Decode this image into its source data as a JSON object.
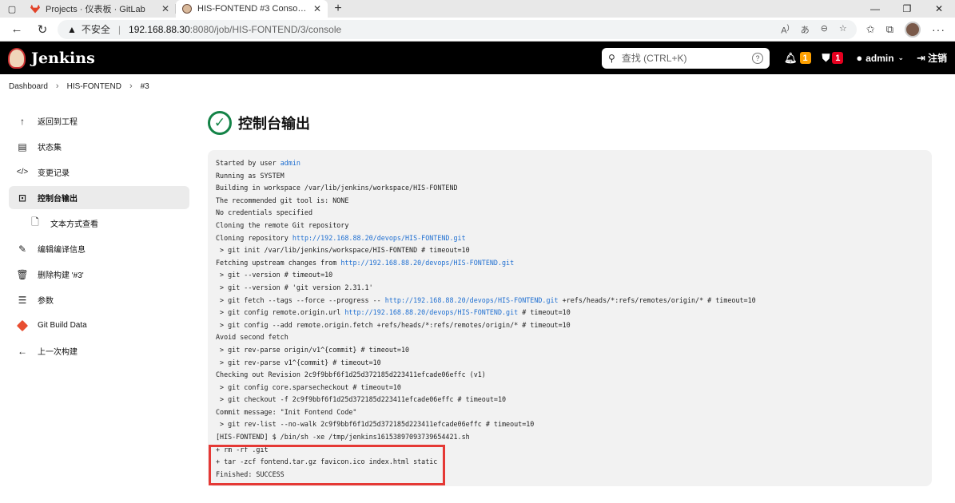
{
  "browser": {
    "tabs": [
      {
        "title": "Projects · 仪表板 · GitLab",
        "active": false
      },
      {
        "title": "HIS-FONTEND #3 Console [Jenkins]",
        "active": true
      }
    ],
    "url": {
      "warning": "不安全",
      "host": "192.168.88.30",
      "path": ":8080/job/HIS-FONTEND/3/console"
    }
  },
  "header": {
    "title": "Jenkins",
    "search_placeholder": "查找 (CTRL+K)",
    "notifications_count": "1",
    "security_count": "1",
    "user": "admin",
    "logout": "注销"
  },
  "breadcrumb": [
    "Dashboard",
    "HIS-FONTEND",
    "#3"
  ],
  "sidebar": {
    "items": [
      {
        "label": "返回到工程",
        "icon": "arrow-up-icon"
      },
      {
        "label": "状态集",
        "icon": "document-icon"
      },
      {
        "label": "变更记录",
        "icon": "code-icon"
      },
      {
        "label": "控制台输出",
        "icon": "terminal-icon",
        "active": true
      },
      {
        "label": "文本方式查看",
        "icon": "file-icon",
        "sub": true
      },
      {
        "label": "编辑编译信息",
        "icon": "edit-icon"
      },
      {
        "label": "删除构建 '#3'",
        "icon": "trash-icon"
      },
      {
        "label": "参数",
        "icon": "sliders-icon"
      },
      {
        "label": "Git Build Data",
        "icon": "git-icon"
      },
      {
        "label": "上一次构建",
        "icon": "arrow-left-icon"
      }
    ]
  },
  "main": {
    "title": "控制台输出"
  },
  "console": {
    "lines": [
      {
        "pre": "Started by user ",
        "link": "admin",
        "post": ""
      },
      {
        "pre": "Running as SYSTEM"
      },
      {
        "pre": "Building in workspace /var/lib/jenkins/workspace/HIS-FONTEND"
      },
      {
        "pre": "The recommended git tool is: NONE"
      },
      {
        "pre": "No credentials specified"
      },
      {
        "pre": "Cloning the remote Git repository"
      },
      {
        "pre": "Cloning repository ",
        "link": "http://192.168.88.20/devops/HIS-FONTEND.git",
        "post": ""
      },
      {
        "pre": " > git init /var/lib/jenkins/workspace/HIS-FONTEND # timeout=10"
      },
      {
        "pre": "Fetching upstream changes from ",
        "link": "http://192.168.88.20/devops/HIS-FONTEND.git",
        "post": ""
      },
      {
        "pre": " > git --version # timeout=10"
      },
      {
        "pre": " > git --version # 'git version 2.31.1'"
      },
      {
        "pre": " > git fetch --tags --force --progress -- ",
        "link": "http://192.168.88.20/devops/HIS-FONTEND.git",
        "post": " +refs/heads/*:refs/remotes/origin/* # timeout=10"
      },
      {
        "pre": " > git config remote.origin.url ",
        "link": "http://192.168.88.20/devops/HIS-FONTEND.git",
        "post": " # timeout=10"
      },
      {
        "pre": " > git config --add remote.origin.fetch +refs/heads/*:refs/remotes/origin/* # timeout=10"
      },
      {
        "pre": "Avoid second fetch"
      },
      {
        "pre": " > git rev-parse origin/v1^{commit} # timeout=10"
      },
      {
        "pre": " > git rev-parse v1^{commit} # timeout=10"
      },
      {
        "pre": "Checking out Revision 2c9f9bbf6f1d25d372185d223411efcade06effc (v1)"
      },
      {
        "pre": " > git config core.sparsecheckout # timeout=10"
      },
      {
        "pre": " > git checkout -f 2c9f9bbf6f1d25d372185d223411efcade06effc # timeout=10"
      },
      {
        "pre": "Commit message: \"Init Fontend Code\""
      },
      {
        "pre": " > git rev-list --no-walk 2c9f9bbf6f1d25d372185d223411efcade06effc # timeout=10"
      },
      {
        "pre": "[HIS-FONTEND] $ /bin/sh -xe /tmp/jenkins16153897093739654421.sh"
      },
      {
        "pre": "+ rm -rf .git"
      },
      {
        "pre": "+ tar -zcf fontend.tar.gz favicon.ico index.html static"
      },
      {
        "pre": "Finished: SUCCESS"
      }
    ]
  },
  "colors": {
    "header_bg": "#000000",
    "link": "#1f6fd1",
    "success": "#138347",
    "highlight": "#e53935",
    "badge_orange": "#fea000",
    "badge_red": "#e6001f"
  }
}
